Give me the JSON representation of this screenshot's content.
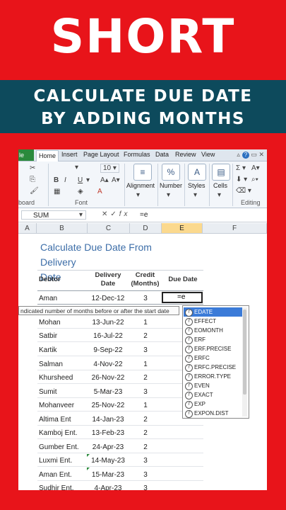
{
  "banner": {
    "short": "SHORT",
    "line1": "CALCULATE DUE DATE",
    "line2": "BY ADDING MONTHS"
  },
  "ribbon": {
    "tabs": [
      "le",
      "Home",
      "Insert",
      "Page Layout",
      "Formulas",
      "Data",
      "Review",
      "View"
    ],
    "font_size": "10",
    "groups": {
      "clipboard": "board",
      "font": "Font",
      "alignment": "Alignment",
      "number": "Number",
      "styles": "Styles",
      "cells": "Cells",
      "editing": "Editing"
    }
  },
  "formula_bar": {
    "name_box": "SUM",
    "formula": "=e"
  },
  "columns": [
    "A",
    "B",
    "C",
    "D",
    "E",
    "F"
  ],
  "sheet": {
    "title_line1": "Calculate Due Date From Delivery",
    "title_line2": "Date",
    "headers": {
      "debtor": "Debtor",
      "delivery_1": "Delivery",
      "delivery_2": "Date",
      "credit_1": "Credit",
      "credit_2": "(Months)",
      "due": "Due Date"
    },
    "rows": [
      {
        "name": "Aman",
        "date": "12-Dec-12",
        "credit": "3"
      },
      {
        "name": "Mohan",
        "date": "13-Jun-22",
        "credit": "1"
      },
      {
        "name": "Satbir",
        "date": "16-Jul-22",
        "credit": "2"
      },
      {
        "name": "Kartik",
        "date": "9-Sep-22",
        "credit": "3"
      },
      {
        "name": "Salman",
        "date": "4-Nov-22",
        "credit": "1"
      },
      {
        "name": "Khursheed",
        "date": "26-Nov-22",
        "credit": "2"
      },
      {
        "name": "Sumit",
        "date": "5-Mar-23",
        "credit": "3"
      },
      {
        "name": "Mohanveer",
        "date": "25-Nov-22",
        "credit": "1"
      },
      {
        "name": "Altima Ent",
        "date": "14-Jan-23",
        "credit": "2"
      },
      {
        "name": "Kamboj Ent.",
        "date": "13-Feb-23",
        "credit": "2"
      },
      {
        "name": "Gumber Ent.",
        "date": "24-Apr-23",
        "credit": "2"
      },
      {
        "name": "Luxmi Ent.",
        "date": "14-May-23",
        "credit": "3"
      },
      {
        "name": "Aman Ent.",
        "date": "15-Mar-23",
        "credit": "3"
      },
      {
        "name": "Sudhir Ent.",
        "date": "4-Apr-23",
        "credit": "3"
      }
    ],
    "active_cell_value": "=e",
    "tooltip": "ndicated number of months before or after the start date"
  },
  "autocomplete": {
    "items": [
      "EDATE",
      "EFFECT",
      "EOMONTH",
      "ERF",
      "ERF.PRECISE",
      "ERFC",
      "ERFC.PRECISE",
      "ERROR.TYPE",
      "EVEN",
      "EXACT",
      "EXP",
      "EXPON.DIST"
    ],
    "selected_index": 0
  },
  "colors": {
    "background_red": "#e8141a",
    "banner_teal": "#0d4a5c",
    "title_blue": "#3d6ea8",
    "file_tab_green": "#2a8a3c",
    "selected_item_blue": "#3b7bd8"
  }
}
